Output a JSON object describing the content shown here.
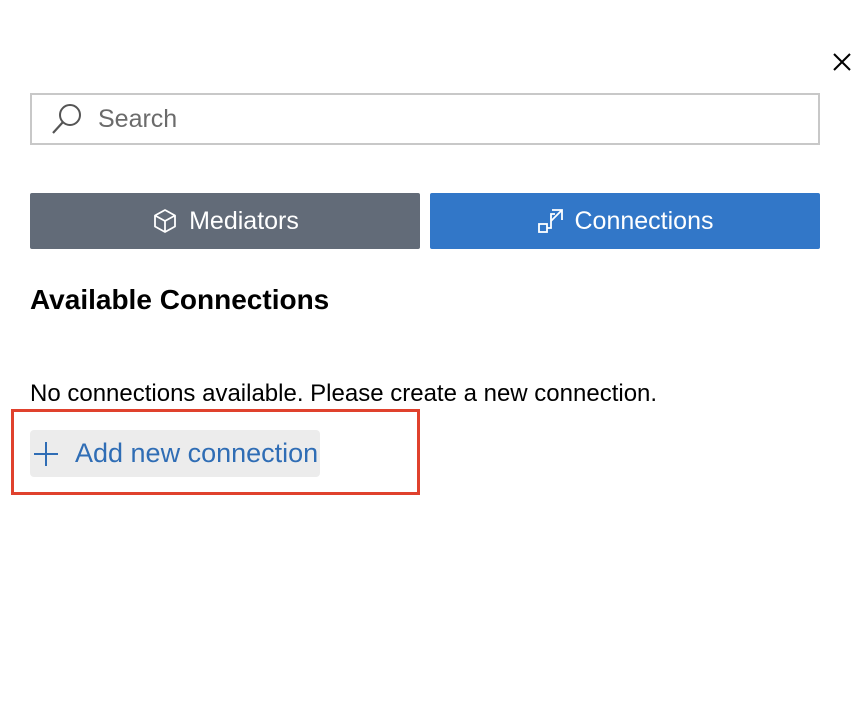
{
  "search": {
    "placeholder": "Search",
    "icon": "search-icon"
  },
  "close": {
    "icon": "close-icon"
  },
  "tabs": [
    {
      "label": "Mediators",
      "icon": "cube-icon",
      "active": false,
      "color": "#626b78"
    },
    {
      "label": "Connections",
      "icon": "connection-icon",
      "active": true,
      "color": "#3277c8"
    }
  ],
  "section": {
    "title": "Available Connections",
    "empty_message": "No connections available. Please create a new connection."
  },
  "add_connection": {
    "label": "Add new connection",
    "icon": "plus-icon",
    "color": "#2f6db5",
    "highlight_color": "#e0412d"
  }
}
